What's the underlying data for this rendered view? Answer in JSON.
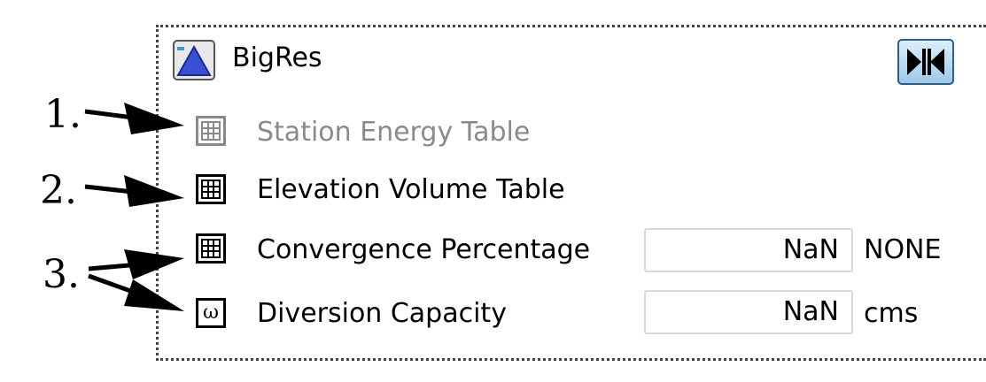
{
  "window": {
    "title": "BigRes"
  },
  "items": [
    {
      "label": "Station Energy Table",
      "icon": "table-grid-icon"
    },
    {
      "label": "Elevation Volume Table",
      "icon": "table-grid-icon"
    },
    {
      "label": "Convergence Percentage",
      "icon": "table-grid-icon",
      "value": "NaN",
      "unit": "NONE"
    },
    {
      "label": "Diversion Capacity",
      "icon": "omega-icon",
      "value": "NaN",
      "unit": "cms"
    }
  ],
  "callouts": [
    "1.",
    "2.",
    "3."
  ]
}
